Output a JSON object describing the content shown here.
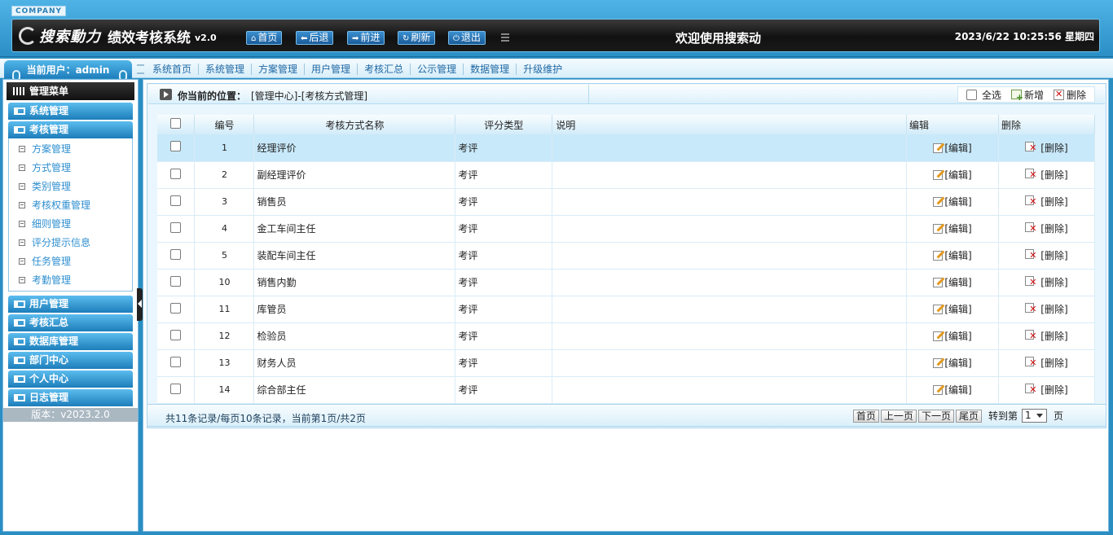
{
  "header": {
    "company": "COMPANY",
    "brand": "搜索動力",
    "system_name": "绩效考核系统",
    "version": "v2.0",
    "buttons": [
      {
        "icon": "home-icon",
        "glyph": "⌂",
        "label": "首页"
      },
      {
        "icon": "back-arrow-icon",
        "glyph": "⬅",
        "label": "后退"
      },
      {
        "icon": "forward-arrow-icon",
        "glyph": "➡",
        "label": "前进"
      },
      {
        "icon": "refresh-icon",
        "glyph": "↻",
        "label": "刷新"
      },
      {
        "icon": "power-icon",
        "glyph": "⏻",
        "label": "退出"
      }
    ],
    "welcome": "欢迎使用搜索动",
    "datetime": "2023/6/22 10:25:56 星期四"
  },
  "nav": {
    "current_user": "当前用户：admin",
    "links": [
      "系统首页",
      "系统管理",
      "方案管理",
      "用户管理",
      "考核汇总",
      "公示管理",
      "数据管理",
      "升级维护"
    ]
  },
  "sidebar": {
    "title": "管理菜单",
    "groups_top": [
      "系统管理",
      "考核管理"
    ],
    "sub_items": [
      "方案管理",
      "方式管理",
      "类别管理",
      "考核权重管理",
      "细则管理",
      "评分提示信息",
      "任务管理",
      "考勤管理"
    ],
    "groups_bottom": [
      "用户管理",
      "考核汇总",
      "数据库管理",
      "部门中心",
      "个人中心",
      "日志管理"
    ],
    "version": "版本：v2023.2.0"
  },
  "main": {
    "location_label": "你当前的位置：",
    "location_path": "[管理中心]-[考核方式管理]",
    "tools": {
      "select_all": "全选",
      "add": "新增",
      "delete": "删除"
    },
    "columns": [
      "编号",
      "考核方式名称",
      "评分类型",
      "说明",
      "编辑",
      "删除"
    ],
    "edit_label": "[编辑]",
    "delete_label": "[删除]",
    "rows": [
      {
        "id": "1",
        "name": "经理评价",
        "type": "考评",
        "desc": ""
      },
      {
        "id": "2",
        "name": "副经理评价",
        "type": "考评",
        "desc": ""
      },
      {
        "id": "3",
        "name": "销售员",
        "type": "考评",
        "desc": ""
      },
      {
        "id": "4",
        "name": "金工车间主任",
        "type": "考评",
        "desc": ""
      },
      {
        "id": "5",
        "name": "装配车间主任",
        "type": "考评",
        "desc": ""
      },
      {
        "id": "10",
        "name": "销售内勤",
        "type": "考评",
        "desc": ""
      },
      {
        "id": "11",
        "name": "库管员",
        "type": "考评",
        "desc": ""
      },
      {
        "id": "12",
        "name": "检验员",
        "type": "考评",
        "desc": ""
      },
      {
        "id": "13",
        "name": "财务人员",
        "type": "考评",
        "desc": ""
      },
      {
        "id": "14",
        "name": "综合部主任",
        "type": "考评",
        "desc": ""
      }
    ],
    "selected_row": 0
  },
  "pager": {
    "info": "共11条记录/每页10条记录，当前第1页/共2页",
    "buttons": [
      "首页",
      "上一页",
      "下一页",
      "尾页"
    ],
    "goto_label": "转到第",
    "page_value": "1",
    "page_unit": "页"
  },
  "colors": {
    "accent": "#2a8ec2",
    "header_dark": "#111111",
    "selected_row": "#c8e9fa"
  }
}
